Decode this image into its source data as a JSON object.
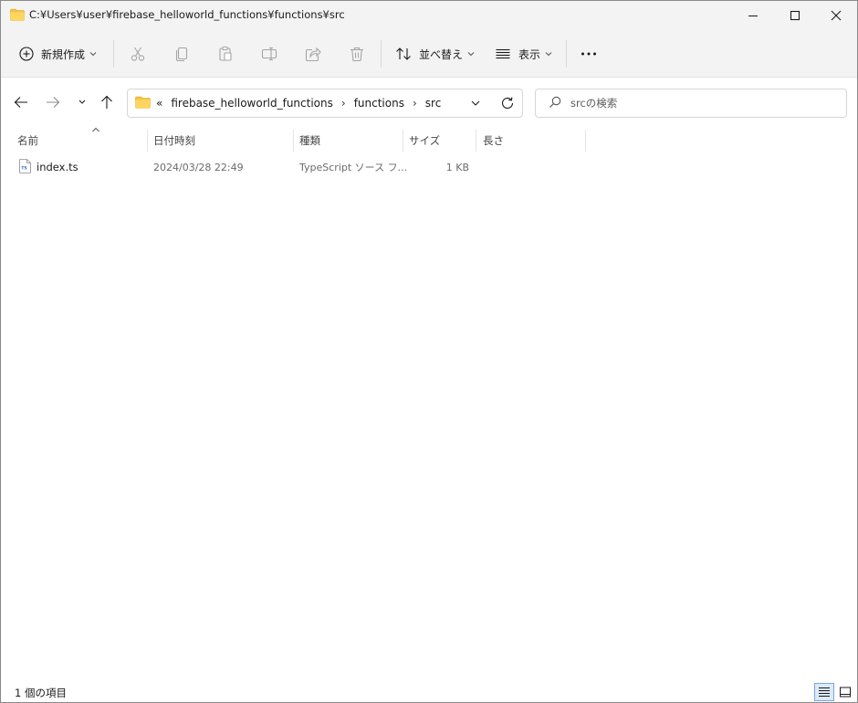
{
  "window": {
    "title": "C:¥Users¥user¥firebase_helloworld_functions¥functions¥src"
  },
  "toolbar": {
    "new_label": "新規作成",
    "sort_label": "並べ替え",
    "view_label": "表示",
    "icons": [
      "cut-icon",
      "copy-icon",
      "paste-icon",
      "rename-icon",
      "share-icon",
      "delete-icon"
    ]
  },
  "address": {
    "overflow": "«",
    "crumbs": [
      "firebase_helloworld_functions",
      "functions",
      "src"
    ],
    "separator": "›"
  },
  "search": {
    "placeholder": "srcの検索"
  },
  "columns": {
    "name": "名前",
    "date": "日付時刻",
    "type": "種類",
    "size": "サイズ",
    "length": "長さ"
  },
  "files": [
    {
      "name": "index.ts",
      "date": "2024/03/28 22:49",
      "type": "TypeScript ソース フ...",
      "size": "1 KB",
      "icon_text": "TS"
    }
  ],
  "status": {
    "item_count": "1 個の項目"
  },
  "colors": {
    "folder": "#f5c242",
    "accent": "#0067c0",
    "chrome": "#f3f3f3"
  }
}
